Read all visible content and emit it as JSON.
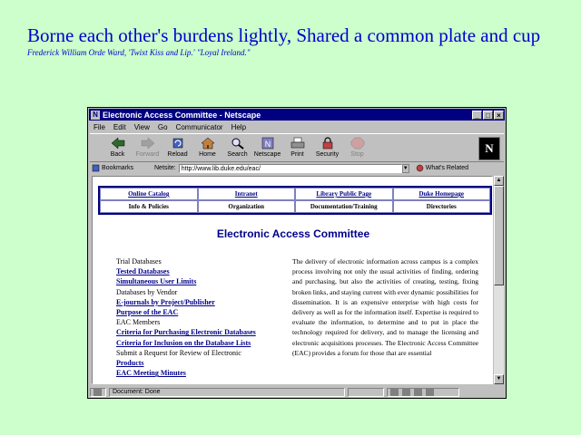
{
  "slide": {
    "title": "Borne each other's burdens lightly, Shared a common plate and cup",
    "caption": "Frederick William Orde Ward, 'Twixt Kiss and Lip.' \"Loyal Ireland.\""
  },
  "window": {
    "title": "Electronic Access Committee - Netscape",
    "minimize": "_",
    "maximize": "□",
    "close": "×"
  },
  "menu": [
    "File",
    "Edit",
    "View",
    "Go",
    "Communicator",
    "Help"
  ],
  "toolbar": {
    "buttons": [
      {
        "label": "Back",
        "icon": "back-arrow-icon",
        "enabled": true
      },
      {
        "label": "Forward",
        "icon": "forward-arrow-icon",
        "enabled": false
      },
      {
        "label": "Reload",
        "icon": "reload-icon",
        "enabled": true
      },
      {
        "label": "Home",
        "icon": "home-icon",
        "enabled": true
      },
      {
        "label": "Search",
        "icon": "search-icon",
        "enabled": true
      },
      {
        "label": "Netscape",
        "icon": "netscape-icon",
        "enabled": true
      },
      {
        "label": "Print",
        "icon": "print-icon",
        "enabled": true
      },
      {
        "label": "Security",
        "icon": "security-lock-icon",
        "enabled": true
      },
      {
        "label": "Stop",
        "icon": "stop-icon",
        "enabled": false
      }
    ],
    "logo": "N"
  },
  "location": {
    "bookmarks_label": "Bookmarks",
    "netsite_label": "Netsite:",
    "url": "http://www.lib.duke.edu/eac/",
    "whats_related": "What's Related"
  },
  "nav": {
    "row1": [
      "Online Catalog",
      "Intranet",
      "Library Public Page",
      "Duke Homepage"
    ],
    "row2": [
      "Info & Policies",
      "Organization",
      "Documentation/Training",
      "Directories"
    ]
  },
  "page": {
    "heading": "Electronic Access Committee",
    "links": [
      {
        "text": "Trial Databases",
        "link": false
      },
      {
        "text": "Tested Databases",
        "link": true
      },
      {
        "text": "Simultaneous User Limits",
        "link": true
      },
      {
        "text": "Databases by Vendor",
        "link": false
      },
      {
        "text": "E-journals by Project/Publisher",
        "link": true
      },
      {
        "text": "Purpose of the EAC",
        "link": true
      },
      {
        "text": "EAC Members",
        "link": false
      },
      {
        "text": "Criteria for Purchasing Electronic Databases",
        "link": true
      },
      {
        "text": "Criteria for Inclusion on the Database Lists",
        "link": true
      },
      {
        "text": "Submit a Request for Review of Electronic",
        "link": false
      },
      {
        "text": "Products",
        "link": true
      },
      {
        "text": "EAC Meeting Minutes",
        "link": true
      }
    ],
    "description": "The delivery of electronic information across campus is a complex process involving not only the usual activities of finding, ordering and purchasing, but also the activities of creating, testing, fixing broken links, and staying current with ever dynamic possibilities for dissemination. It is an expensive enterprise with high costs for delivery as well as for the information itself. Expertise is required to evaluate the information, to determine and to put in place the technology required for delivery, and to manage the licensing and electronic acquisitions processes. The Electronic Access Committee (EAC) provides a forum for those that are essential"
  },
  "status": {
    "text": "Document: Done"
  },
  "colors": {
    "slide_background": "#ccffcc",
    "slide_text": "#0000cc",
    "titlebar": "#000080",
    "link": "#00008b"
  }
}
